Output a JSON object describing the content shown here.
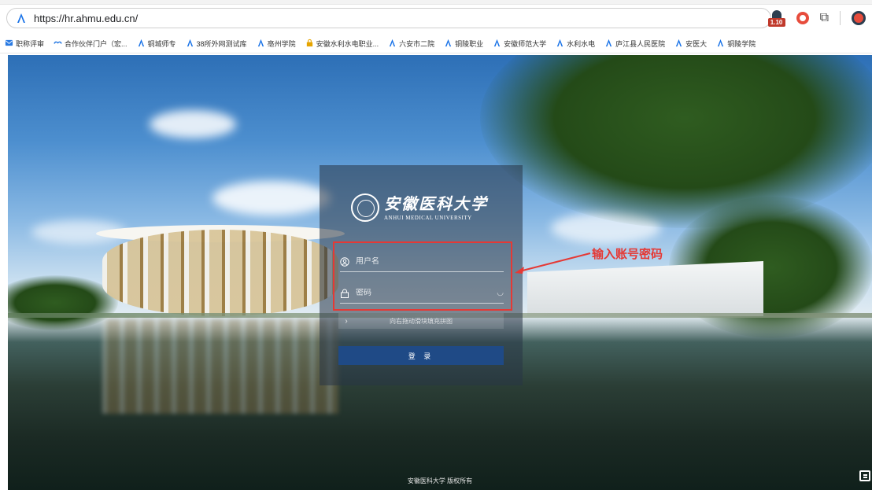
{
  "browser": {
    "url": "https://hr.ahmu.edu.cn/",
    "extension_badge": "1.10"
  },
  "bookmarks": [
    {
      "label": "职称评审",
      "icon": "envelope-icon",
      "color": "#2a7ae2"
    },
    {
      "label": "合作伙伴门户（宏...",
      "icon": "handshake-icon",
      "color": "#2a7ae2"
    },
    {
      "label": "铜城师专",
      "icon": "person-logo-icon",
      "color": "#1a73e8"
    },
    {
      "label": "38所外网测试库",
      "icon": "person-logo-icon",
      "color": "#1a73e8"
    },
    {
      "label": "亳州学院",
      "icon": "person-logo-icon",
      "color": "#1a73e8"
    },
    {
      "label": "安徽水利水电职业...",
      "icon": "lock-icon",
      "color": "#e6a400"
    },
    {
      "label": "六安市二院",
      "icon": "person-logo-icon",
      "color": "#1a73e8"
    },
    {
      "label": "铜陵职业",
      "icon": "person-logo-icon",
      "color": "#1a73e8"
    },
    {
      "label": "安徽师范大学",
      "icon": "person-logo-icon",
      "color": "#1a73e8"
    },
    {
      "label": "水利水电",
      "icon": "person-logo-icon",
      "color": "#1a73e8"
    },
    {
      "label": "庐江县人民医院",
      "icon": "person-logo-icon",
      "color": "#1a73e8"
    },
    {
      "label": "安医大",
      "icon": "person-logo-icon",
      "color": "#1a73e8"
    },
    {
      "label": "铜陵学院",
      "icon": "person-logo-icon",
      "color": "#1a73e8"
    }
  ],
  "login": {
    "logo_cn": "安徽医科大学",
    "logo_en": "ANHUI MEDICAL UNIVERSITY",
    "username_placeholder": "用户名",
    "password_placeholder": "密码",
    "slider_text": "向右拖动滑块填充拼图",
    "submit_label": "登 录"
  },
  "annotation": {
    "label": "输入账号密码",
    "color": "#e53935"
  },
  "footer": {
    "copyright": "安徽医科大学 版权所有"
  },
  "colors": {
    "login_button": "#1f4a86",
    "panel": "rgba(40,52,70,0.55)"
  }
}
